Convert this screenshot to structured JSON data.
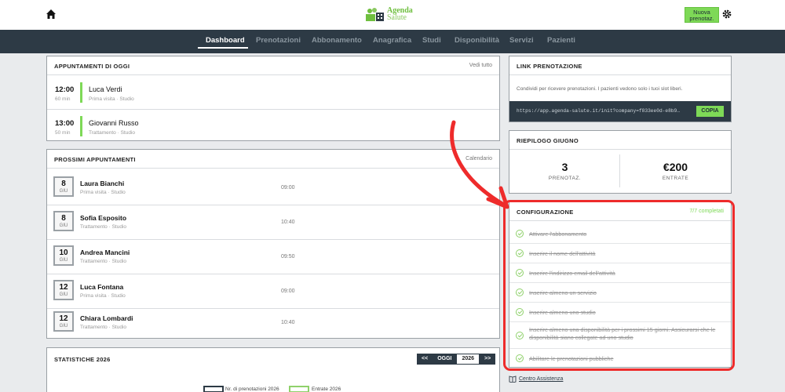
{
  "header": {
    "logo_line1": "Agenda",
    "logo_line2": "Salute",
    "new_button_line1": "Nuova",
    "new_button_line2": "prenotaz."
  },
  "nav": {
    "items": [
      "Dashboard",
      "Prenotazioni",
      "Abbonamento",
      "Anagrafica",
      "Studi",
      "Disponibilità",
      "Servizi",
      "Pazienti"
    ],
    "active": "Dashboard"
  },
  "today": {
    "title": "APPUNTAMENTI DI OGGI",
    "link": "Vedi tutto",
    "items": [
      {
        "time": "12:00",
        "duration": "60 min",
        "name": "Luca Verdi",
        "detail": "Prima visita · Studio"
      },
      {
        "time": "13:00",
        "duration": "50 min",
        "name": "Giovanni Russo",
        "detail": "Trattamento · Studio"
      }
    ]
  },
  "upcoming": {
    "title": "PROSSIMI APPUNTAMENTI",
    "link": "Calendario",
    "items": [
      {
        "day": "8",
        "month": "GIU",
        "name": "Laura Bianchi",
        "detail": "Prima visita · Studio",
        "time": "09:00"
      },
      {
        "day": "8",
        "month": "GIU",
        "name": "Sofia Esposito",
        "detail": "Trattamento · Studio",
        "time": "10:40"
      },
      {
        "day": "10",
        "month": "GIU",
        "name": "Andrea Mancini",
        "detail": "Trattamento · Studio",
        "time": "09:50"
      },
      {
        "day": "12",
        "month": "GIU",
        "name": "Luca Fontana",
        "detail": "Prima visita · Studio",
        "time": "09:00"
      },
      {
        "day": "12",
        "month": "GIU",
        "name": "Chiara Lombardi",
        "detail": "Trattamento · Studio",
        "time": "10:40"
      }
    ]
  },
  "stats": {
    "title": "STATISTICHE 2026",
    "prev": "<<",
    "today": "OGGI",
    "year": "2026",
    "next": ">>",
    "legend_bookings": "Nr. di prenotazioni 2026",
    "legend_revenue": "Entrate 2026"
  },
  "booking_link": {
    "title": "LINK PRENOTAZIONE",
    "description": "Condividi per ricevere prenotazioni. I pazienti vedono solo i tuoi slot liberi.",
    "url": "https://app.agenda-salute.it/init?company=f833ee0d-e8b9…",
    "copy_label": "COPIA"
  },
  "summary": {
    "title": "RIEPILOGO GIUGNO",
    "bookings_value": "3",
    "bookings_label": "PRENOTAZ.",
    "revenue_value": "€200",
    "revenue_label": "ENTRATE"
  },
  "config": {
    "title": "CONFIGURAZIONE",
    "count": "7/7 completati",
    "items": [
      "Attivare l'abbonamento",
      "Inserire il nome dell'attività",
      "Inserire l'indirizzo email dell'attività",
      "Inserire almeno un servizio",
      "Inserire almeno uno studio",
      "Inserire almeno una disponibilità per i prossimi 15 giorni. Assicurarsi che le disponibilità siano collegate ad uno studio",
      "Abilitare le prenotazioni pubbliche"
    ]
  },
  "help_link": "Centro Assistenza",
  "colors": {
    "accent": "#7ed957",
    "nav": "#2d3a45",
    "annotation": "#ee2b2b"
  }
}
